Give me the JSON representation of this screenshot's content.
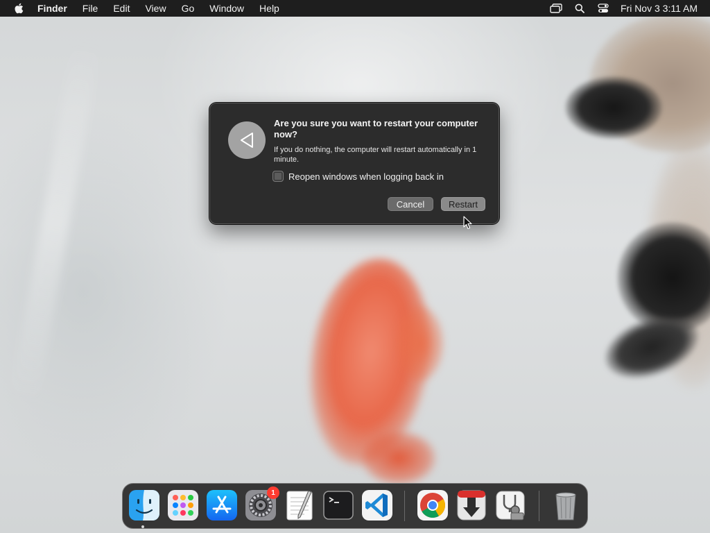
{
  "menubar": {
    "app_name": "Finder",
    "menus": [
      "File",
      "Edit",
      "View",
      "Go",
      "Window",
      "Help"
    ],
    "clock": "Fri Nov 3  3:11 AM",
    "status_icons": [
      "screen-mirroring-icon",
      "spotlight-search-icon",
      "control-center-icon"
    ]
  },
  "dialog": {
    "title": "Are you sure you want to restart your computer now?",
    "message": "If you do nothing, the computer will restart automatically in 1 minute.",
    "checkbox_label": "Reopen windows when logging back in",
    "checkbox_checked": false,
    "cancel_label": "Cancel",
    "restart_label": "Restart",
    "icon": "restart-triangle-icon"
  },
  "dock": {
    "apps": [
      {
        "name": "Finder",
        "icon": "finder-icon",
        "running": true
      },
      {
        "name": "Launchpad",
        "icon": "launchpad-icon"
      },
      {
        "name": "App Store",
        "icon": "app-store-icon"
      },
      {
        "name": "System Settings",
        "icon": "system-settings-icon",
        "badge": "1"
      },
      {
        "name": "TextEdit",
        "icon": "textedit-icon"
      },
      {
        "name": "Terminal",
        "icon": "terminal-icon"
      },
      {
        "name": "Visual Studio Code",
        "icon": "vscode-icon"
      },
      {
        "name": "Google Chrome",
        "icon": "chrome-icon"
      },
      {
        "name": "Transmission",
        "icon": "transmission-icon"
      },
      {
        "name": "Disk Utility",
        "icon": "disk-utility-icon"
      },
      {
        "name": "Trash",
        "icon": "trash-icon"
      }
    ]
  },
  "colors": {
    "menubar_bg": "#1e1e1e",
    "dialog_bg": "#2c2c2c",
    "badge_red": "#ff3b30"
  }
}
